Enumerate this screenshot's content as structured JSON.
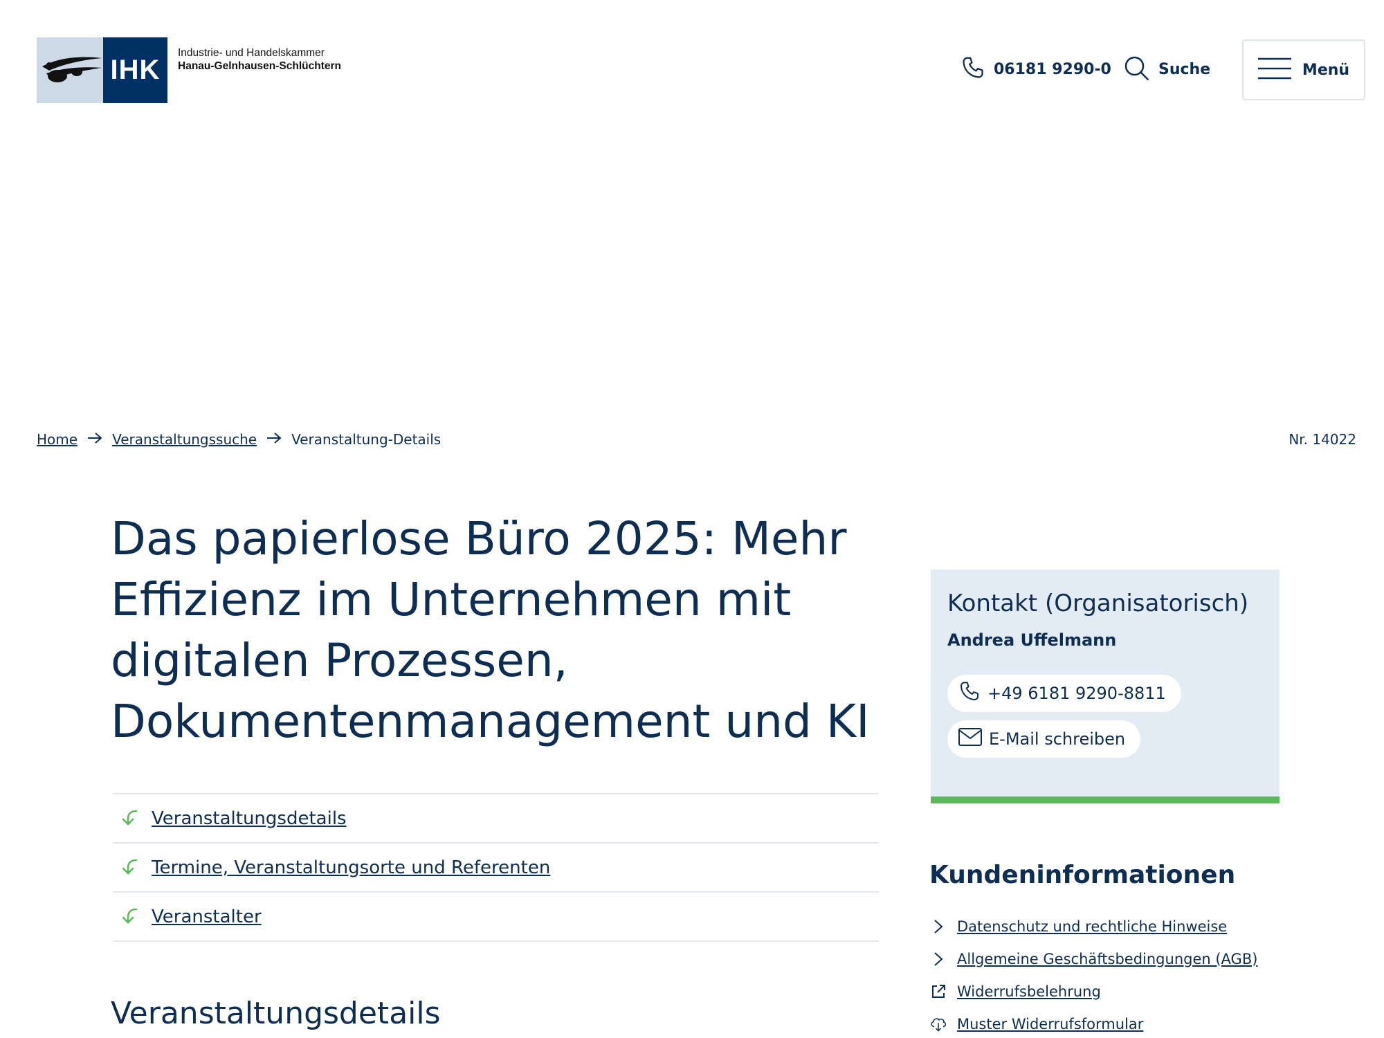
{
  "header": {
    "logo_text": "IHK",
    "org_line1": "Industrie- und Handelskammer",
    "org_line2": "Hanau-Gelnhausen-Schlüchtern",
    "phone": "06181 9290-0",
    "search_label": "Suche",
    "menu_label": "Menü"
  },
  "breadcrumb": {
    "items": [
      "Home",
      "Veranstaltungssuche"
    ],
    "current": "Veranstaltung-Details",
    "nr": "Nr. 14022"
  },
  "title_lines": [
    "Das papierlose Büro 2025: Mehr",
    "Effizienz im Unternehmen mit",
    "digitalen Prozessen,",
    "Dokumentenmanagement und KI"
  ],
  "anchors": [
    "Veranstaltungsdetails",
    "Termine, Veranstaltungsorte und Referenten",
    "Veranstalter"
  ],
  "section_title": "Veranstaltungsdetails",
  "contact": {
    "title": "Kontakt (Organisatorisch)",
    "name": "Andrea Uffelmann",
    "phone": "+49 6181 9290-8811",
    "email_label": "E-Mail schreiben"
  },
  "customer_info": {
    "title": "Kundeninformationen",
    "items": [
      {
        "label": "Datenschutz und rechtliche Hinweise",
        "icon": "chevron-right-icon"
      },
      {
        "label": "Allgemeine Geschäftsbedingungen (AGB)",
        "icon": "chevron-right-icon"
      },
      {
        "label": "Widerrufsbelehrung",
        "icon": "external-link-icon"
      },
      {
        "label": "Muster Widerrufsformular",
        "icon": "cloud-download-icon"
      }
    ]
  },
  "colors": {
    "primary": "#0e2d52",
    "logo_blue": "#003064",
    "accent_green": "#5cb85c",
    "contact_bg": "#e3ebf4"
  }
}
